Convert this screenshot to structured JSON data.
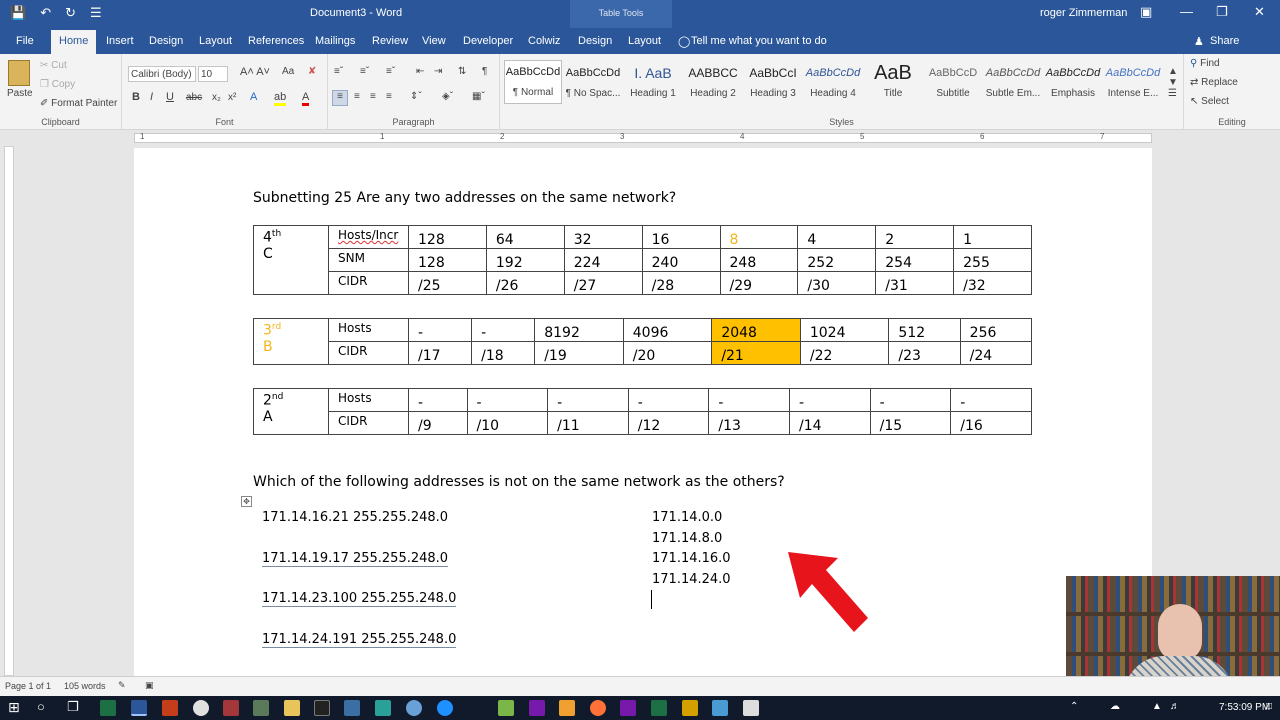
{
  "window": {
    "title": "Document3 - Word",
    "contextual": "Table Tools",
    "user": "roger Zimmerman",
    "qa_icons": [
      "save-icon",
      "undo-icon",
      "redo-icon",
      "customize-icon"
    ]
  },
  "tabs": [
    "File",
    "Home",
    "Insert",
    "Design",
    "Layout",
    "References",
    "Mailings",
    "Review",
    "View",
    "Developer",
    "Colwiz",
    "Design",
    "Layout"
  ],
  "tell_me": "Tell me what you want to do",
  "share": "Share",
  "clipboard": {
    "paste": "Paste",
    "cut": "Cut",
    "copy": "Copy",
    "format_painter": "Format Painter",
    "label": "Clipboard"
  },
  "font": {
    "name": "Calibri (Body)",
    "size": "10",
    "label": "Font"
  },
  "paragraph": {
    "label": "Paragraph"
  },
  "styles": {
    "label": "Styles",
    "items": [
      {
        "preview": "AaBbCcDd",
        "name": "¶ Normal"
      },
      {
        "preview": "AaBbCcDd",
        "name": "¶ No Spac..."
      },
      {
        "preview": "I. AaB",
        "name": "Heading 1"
      },
      {
        "preview": "AABBCC",
        "name": "Heading 2"
      },
      {
        "preview": "AaBbCcI",
        "name": "Heading 3"
      },
      {
        "preview": "AaBbCcDd",
        "name": "Heading 4"
      },
      {
        "preview": "AaB",
        "name": "Title"
      },
      {
        "preview": "AaBbCcD",
        "name": "Subtitle"
      },
      {
        "preview": "AaBbCcDd",
        "name": "Subtle Em..."
      },
      {
        "preview": "AaBbCcDd",
        "name": "Emphasis"
      },
      {
        "preview": "AaBbCcDd",
        "name": "Intense E..."
      }
    ]
  },
  "editing": {
    "find": "Find",
    "replace": "Replace",
    "select": "Select",
    "label": "Editing"
  },
  "ruler": [
    "1",
    "1",
    "2",
    "3",
    "4",
    "5",
    "6",
    "7"
  ],
  "doc": {
    "heading": "Subnetting 25 Are any two addresses on the same network?",
    "tableC": {
      "class_sup": "th",
      "class_num": "4",
      "class_letter": "C",
      "rows": [
        {
          "label": "Hosts/Incr",
          "cells": [
            "128",
            "64",
            "32",
            "16",
            "8",
            "4",
            "2",
            "1"
          ]
        },
        {
          "label": "SNM",
          "cells": [
            "128",
            "192",
            "224",
            "240",
            "248",
            "252",
            "254",
            "255"
          ]
        },
        {
          "label": "CIDR",
          "cells": [
            "/25",
            "/26",
            "/27",
            "/28",
            "/29",
            "/30",
            "/31",
            "/32"
          ]
        }
      ]
    },
    "tableB": {
      "class_sup": "rd",
      "class_num": "3",
      "class_letter": "B",
      "rows": [
        {
          "label": "Hosts",
          "cells": [
            "-",
            "-",
            "8192",
            "4096",
            "2048",
            "1024",
            "512",
            "256"
          ]
        },
        {
          "label": "CIDR",
          "cells": [
            "/17",
            "/18",
            "/19",
            "/20",
            "/21",
            "/22",
            "/23",
            "/24"
          ]
        }
      ]
    },
    "tableA": {
      "class_sup": "nd",
      "class_num": "2",
      "class_letter": "A",
      "rows": [
        {
          "label": "Hosts",
          "cells": [
            "-",
            "-",
            "-",
            "-",
            "-",
            "-",
            "-",
            "-"
          ]
        },
        {
          "label": "CIDR",
          "cells": [
            "/9",
            "/10",
            "/11",
            "/12",
            "/13",
            "/14",
            "/15",
            "/16"
          ]
        }
      ]
    },
    "question": "Which of the following addresses is not on the same network as the others?",
    "addresses": [
      "171.14.16.21 255.255.248.0",
      "171.14.19.17  255.255.248.0",
      "171.14.23.100  255.255.248.0",
      "171.14.24.191  255.255.248.0"
    ],
    "networks": [
      "171.14.0.0",
      "171.14.8.0",
      "171.14.16.0",
      "171.14.24.0"
    ]
  },
  "status": {
    "page": "Page 1 of 1",
    "words": "105 words"
  },
  "clock": "7:53:09 PM",
  "colors": {
    "brand": "#2b579a",
    "highlight": "#ffc000",
    "orange_text": "#f2b51c",
    "arrow": "#e8141c"
  }
}
